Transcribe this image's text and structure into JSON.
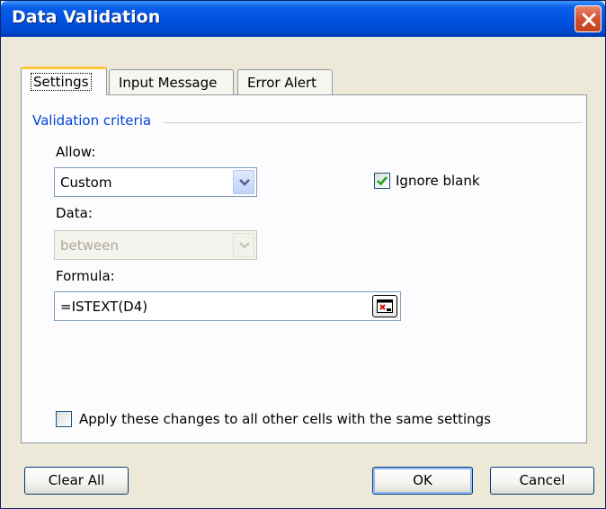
{
  "window": {
    "title": "Data Validation"
  },
  "tabs": [
    {
      "label": "Settings",
      "active": true
    },
    {
      "label": "Input Message",
      "active": false
    },
    {
      "label": "Error Alert",
      "active": false
    }
  ],
  "settings": {
    "group_title": "Validation criteria",
    "allow_label": "Allow:",
    "allow_value": "Custom",
    "ignore_blank_label": "Ignore blank",
    "ignore_blank_checked": true,
    "data_label": "Data:",
    "data_value": "between",
    "formula_label": "Formula:",
    "formula_value": "=ISTEXT(D4)",
    "apply_all_label": "Apply these changes to all other cells with the same settings",
    "apply_all_checked": false
  },
  "buttons": {
    "clear_all": "Clear All",
    "ok": "OK",
    "cancel": "Cancel"
  },
  "icons": {
    "close": "close-icon",
    "dropdown": "chevron-down-icon",
    "check": "checkmark-icon",
    "collapse": "collapse-dialog-icon"
  },
  "colors": {
    "titlebar": "#0054e3",
    "close": "#d2512c",
    "group_title": "#0046d5",
    "face": "#ece9d8",
    "tab_highlight": "#ffc83c"
  }
}
